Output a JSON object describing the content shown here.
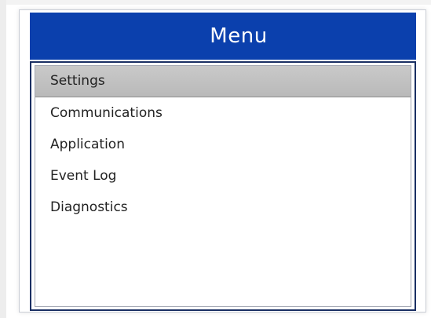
{
  "menu": {
    "title": "Menu",
    "selected_index": 0,
    "items": [
      {
        "label": "Settings"
      },
      {
        "label": "Communications"
      },
      {
        "label": "Application"
      },
      {
        "label": "Event Log"
      },
      {
        "label": "Diagnostics"
      }
    ]
  },
  "colors": {
    "header_bg": "#0b40ad",
    "header_text": "#ffffff",
    "selected_bg": "#c0c0c0",
    "frame_border": "#1a2f63",
    "item_text": "#222222"
  }
}
